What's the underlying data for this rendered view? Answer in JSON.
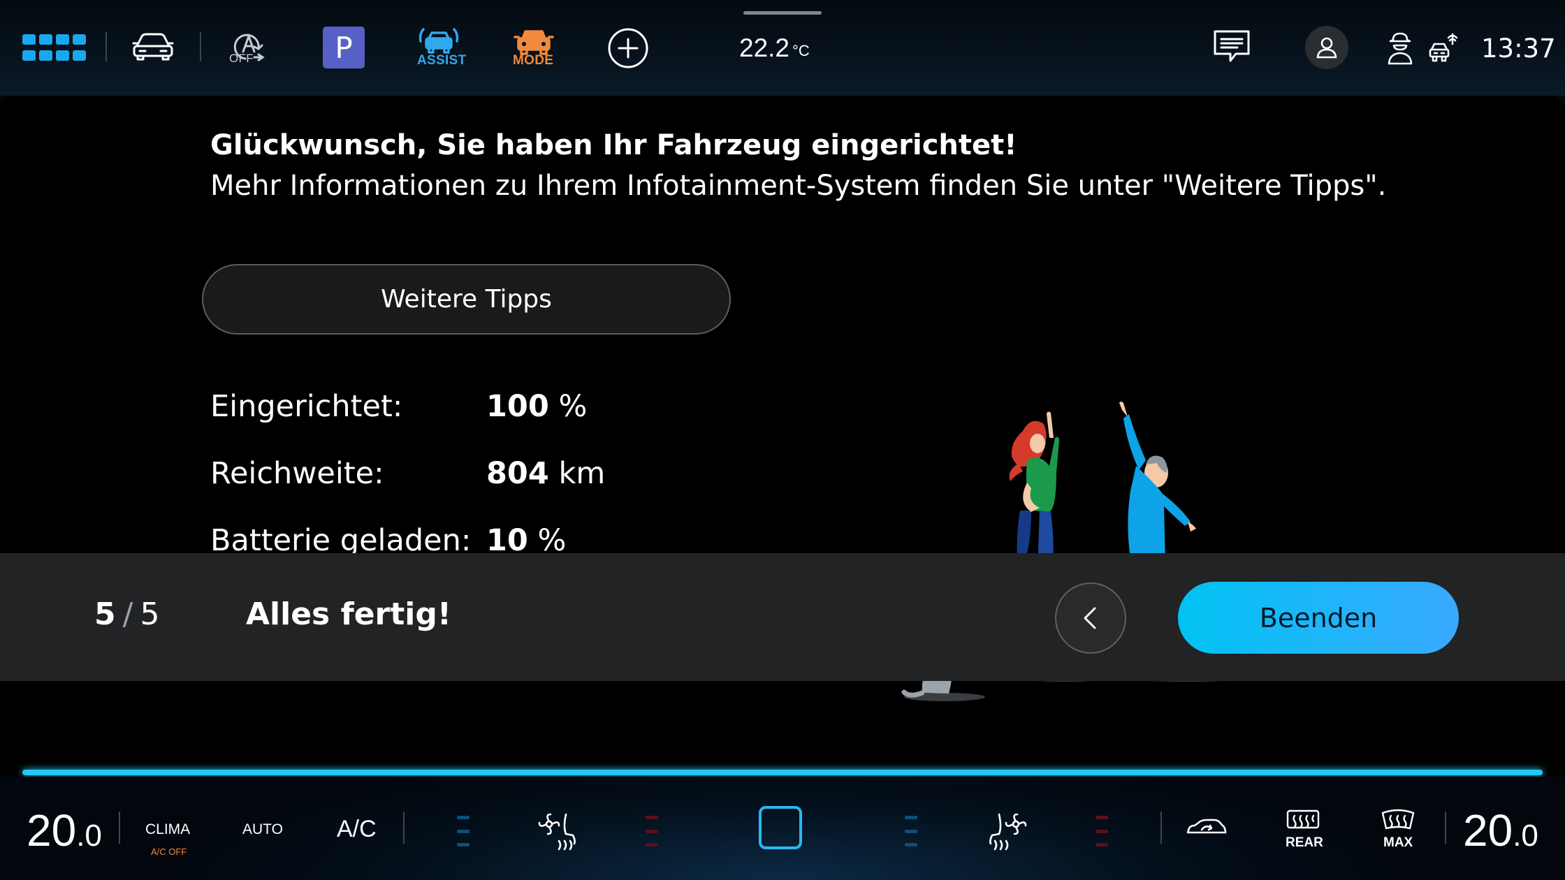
{
  "topbar": {
    "assist_off_label": "OFF",
    "park_label": "P",
    "assist_label": "ASSIST",
    "mode_label": "MODE",
    "temperature_value": "22.2",
    "temperature_unit": "°C",
    "clock": "13:37",
    "colors": {
      "accent_blue": "#1aa7ef",
      "mode_orange": "#f08a3c",
      "park_purple": "#5660c7"
    }
  },
  "main": {
    "headline": "Glückwunsch, Sie haben Ihr Fahrzeug eingerichtet!",
    "subline": "Mehr Informationen zu Ihrem Infotainment-System finden Sie unter \"Weitere Tipps\".",
    "tips_button": "Weitere Tipps",
    "stats": [
      {
        "label": "Eingerichtet:",
        "value": "100",
        "unit": "%"
      },
      {
        "label": "Reichweite:",
        "value": "804",
        "unit": "km"
      },
      {
        "label": "Batterie geladen:",
        "value": "10",
        "unit": "%"
      }
    ]
  },
  "stepbar": {
    "current_step": "5",
    "separator": "/",
    "total_steps": "5",
    "title": "Alles fertig!",
    "finish_button": "Beenden",
    "progress_fraction": 1.0,
    "colors": {
      "finish_start": "#00c3f3",
      "finish_end": "#3aa9ff",
      "progress": "#23c9f6"
    }
  },
  "climate": {
    "left_temp_int": "20",
    "left_temp_dec": ".0",
    "right_temp_int": "20",
    "right_temp_dec": ".0",
    "clima_label": "CLIMA",
    "ac_off_label": "A/C OFF",
    "auto_label": "AUTO",
    "ac_label": "A/C",
    "rear_label": "REAR",
    "max_label": "MAX"
  }
}
